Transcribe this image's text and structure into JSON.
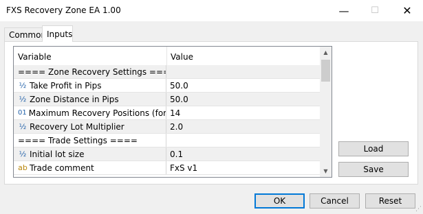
{
  "window": {
    "title": "FXS Recovery Zone EA 1.00",
    "minimize_glyph": "—",
    "maximize_glyph": "☐",
    "close_glyph": "✕"
  },
  "tabs": [
    {
      "label": "Common",
      "active": false
    },
    {
      "label": "Inputs",
      "active": true
    }
  ],
  "table": {
    "columns": [
      "Variable",
      "Value"
    ],
    "rows": [
      {
        "icon": "",
        "variable": "==== Zone Recovery Settings ====",
        "value": ""
      },
      {
        "icon": "½",
        "icon_name": "double-icon",
        "variable": "Take Profit in Pips",
        "value": "50.0"
      },
      {
        "icon": "½",
        "icon_name": "double-icon",
        "variable": "Zone Distance in Pips",
        "value": "50.0"
      },
      {
        "icon": "01",
        "icon_name": "integer-icon",
        "variable": "Maximum Recovery Positions (for safe...",
        "value": "14"
      },
      {
        "icon": "½",
        "icon_name": "double-icon",
        "variable": "Recovery Lot Multiplier",
        "value": "2.0"
      },
      {
        "icon": "",
        "variable": "==== Trade Settings ====",
        "value": ""
      },
      {
        "icon": "½",
        "icon_name": "double-icon",
        "variable": "Initial lot size",
        "value": "0.1"
      },
      {
        "icon": "ab",
        "icon_name": "string-icon",
        "variable": "Trade comment",
        "value": "FxS v1"
      }
    ]
  },
  "buttons": {
    "load": "Load",
    "save": "Save",
    "ok": "OK",
    "cancel": "Cancel",
    "reset": "Reset"
  },
  "scrollbar": {
    "up_glyph": "▲",
    "down_glyph": "▼"
  }
}
